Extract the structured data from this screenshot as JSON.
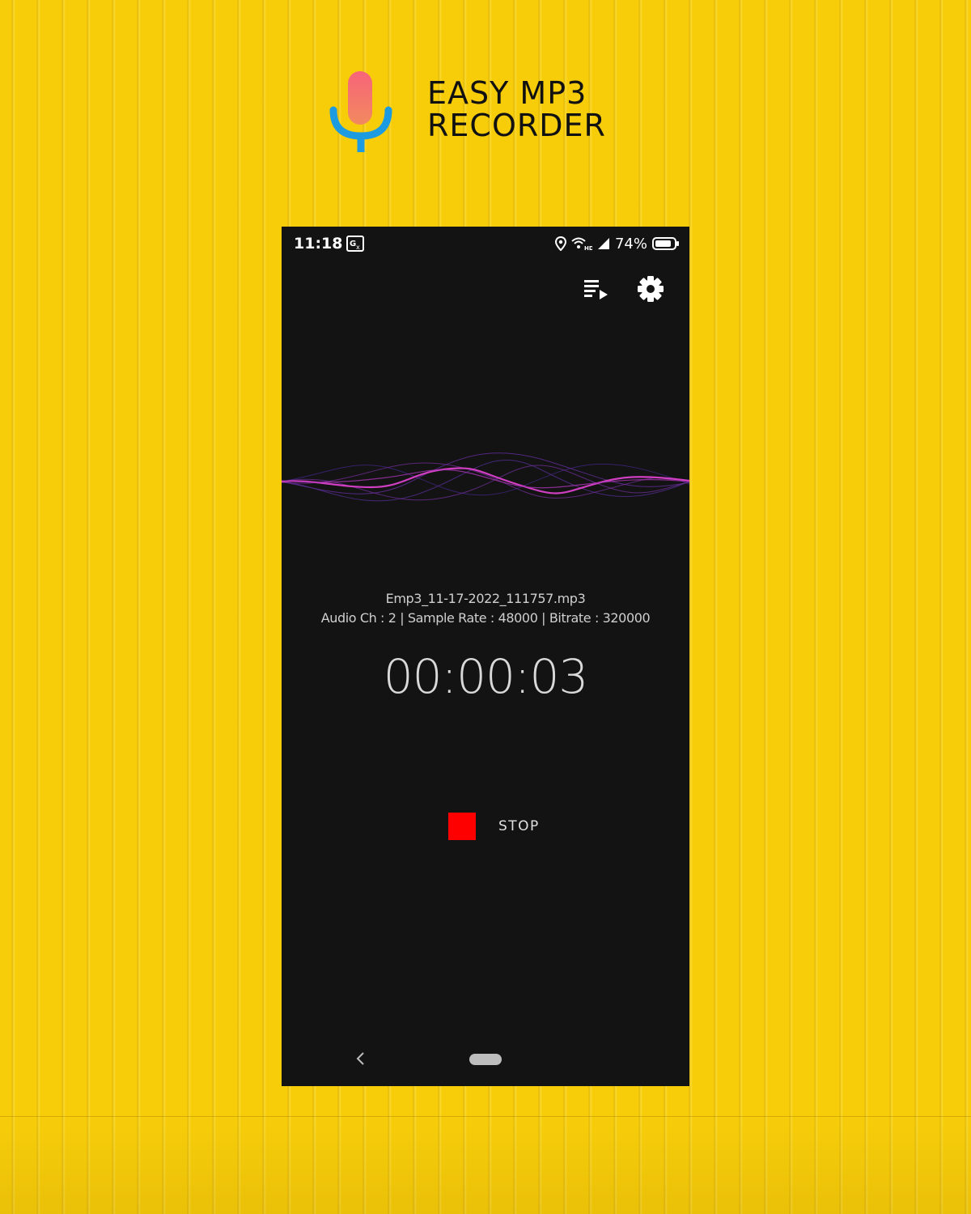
{
  "branding": {
    "logo_icon": "microphone-icon",
    "title_line1": "EASY MP3",
    "title_line2": "RECORDER",
    "colors": {
      "mic_head": "#f36f70",
      "mic_stand": "#1c9be0",
      "background": "#f7cd0a"
    }
  },
  "status_bar": {
    "time": "11:18",
    "icons": [
      "translate-icon",
      "location-icon",
      "wifi-hd-icon",
      "signal-icon",
      "battery-icon"
    ],
    "battery_percent": "74%"
  },
  "toolbar": {
    "playlist_icon": "playlist-icon",
    "settings_icon": "gear-icon"
  },
  "waveform": {
    "colors": [
      "#d03fc2",
      "#5a2a8a",
      "#3a2370"
    ]
  },
  "recording": {
    "file_name": "Emp3_11-17-2022_111757.mp3",
    "audio_info": "Audio Ch : 2 | Sample Rate : 48000 | Bitrate : 320000",
    "elapsed": "00:00:03"
  },
  "controls": {
    "stop_label": "STOP",
    "stop_color": "#ff0000"
  },
  "navigation": {
    "back_icon": "chevron-left-icon",
    "home_icon": "home-pill-icon"
  }
}
